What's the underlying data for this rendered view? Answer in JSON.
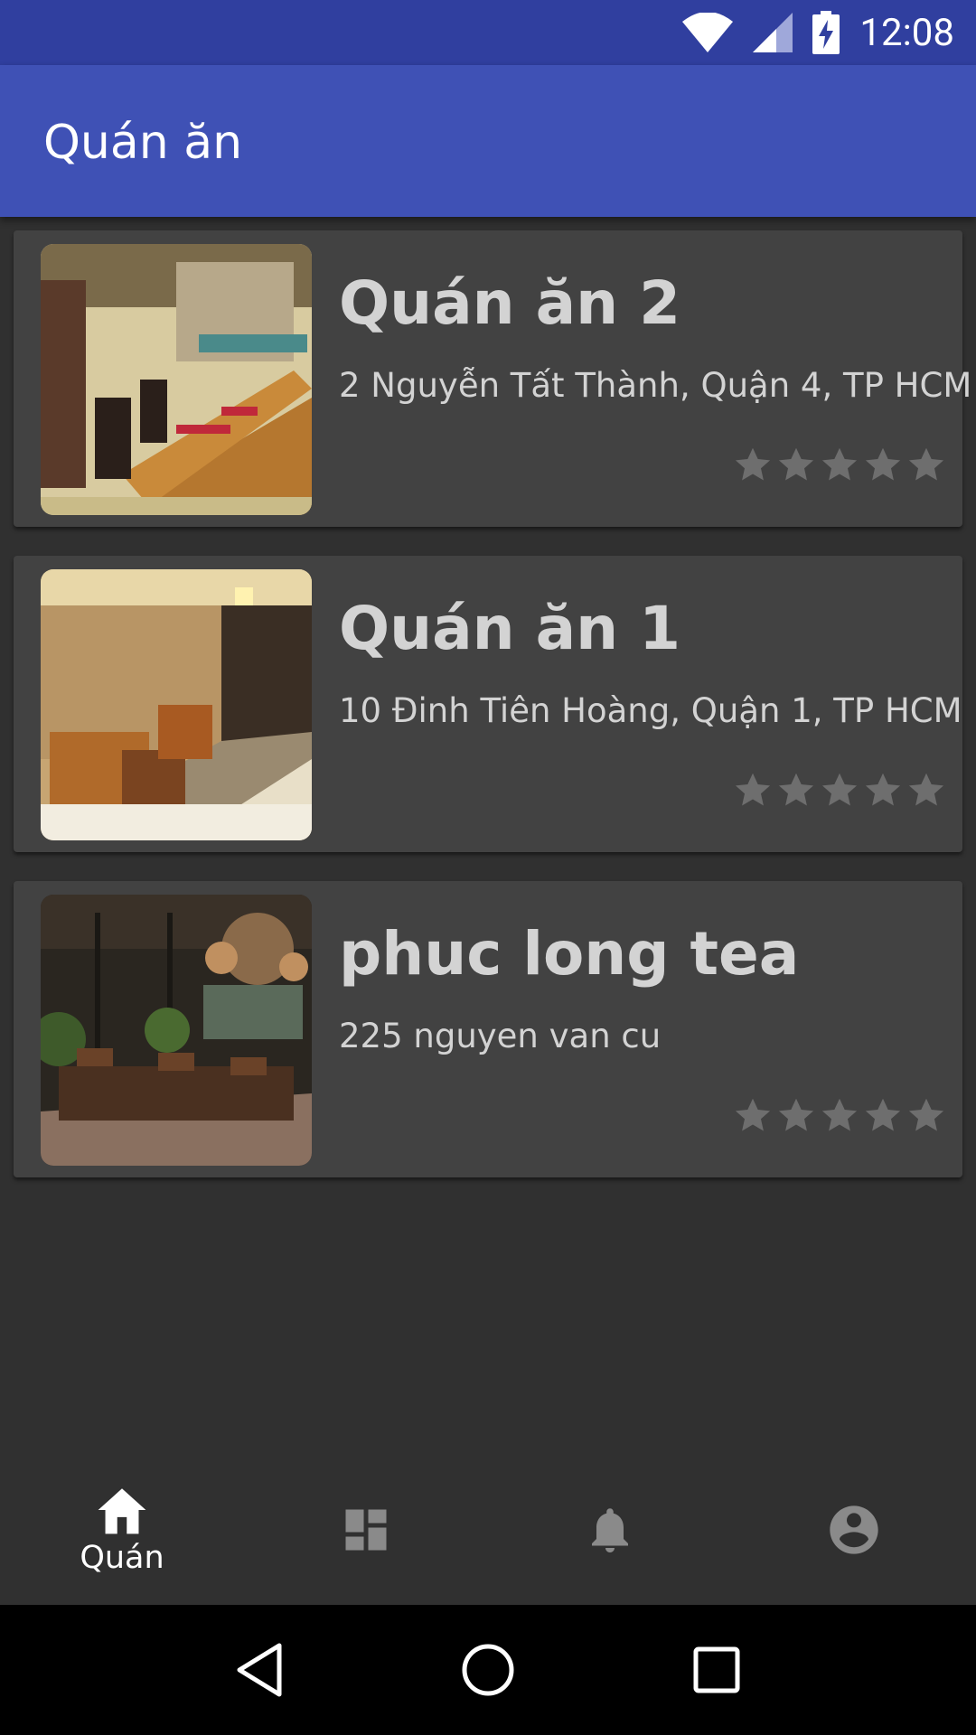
{
  "status_bar": {
    "time": "12:08",
    "icons": [
      "wifi-icon",
      "signal-icon",
      "battery-charging-icon"
    ]
  },
  "app_bar": {
    "title": "Quán ăn"
  },
  "restaurants": [
    {
      "name": "Quán ăn 2",
      "address": "2 Nguyễn Tất Thành, Quận 4, TP HCM",
      "rating": 0,
      "max_rating": 5,
      "image": "restaurant-interior-photo"
    },
    {
      "name": "Quán ăn 1",
      "address": "10 Đinh Tiên Hoàng, Quận 1, TP HCM",
      "rating": 0,
      "max_rating": 5,
      "image": "restaurant-interior-photo"
    },
    {
      "name": "phuc long tea",
      "address": "225 nguyen van cu",
      "rating": 0,
      "max_rating": 5,
      "image": "restaurant-interior-photo"
    }
  ],
  "bottom_nav": {
    "items": [
      {
        "icon": "home-icon",
        "label": "Quán",
        "active": true
      },
      {
        "icon": "dashboard-icon",
        "label": "",
        "active": false
      },
      {
        "icon": "bell-icon",
        "label": "",
        "active": false
      },
      {
        "icon": "account-icon",
        "label": "",
        "active": false
      }
    ]
  },
  "system_nav": {
    "buttons": [
      "back-icon",
      "home-circle-icon",
      "recents-icon"
    ]
  },
  "colors": {
    "status_bar": "#303f9f",
    "app_bar": "#3f51b5",
    "background": "#303030",
    "card": "#424242",
    "text": "#d3d3d3",
    "star": "#6e6e6e",
    "nav_active": "#ffffff",
    "nav_inactive": "#8a8a8a"
  }
}
